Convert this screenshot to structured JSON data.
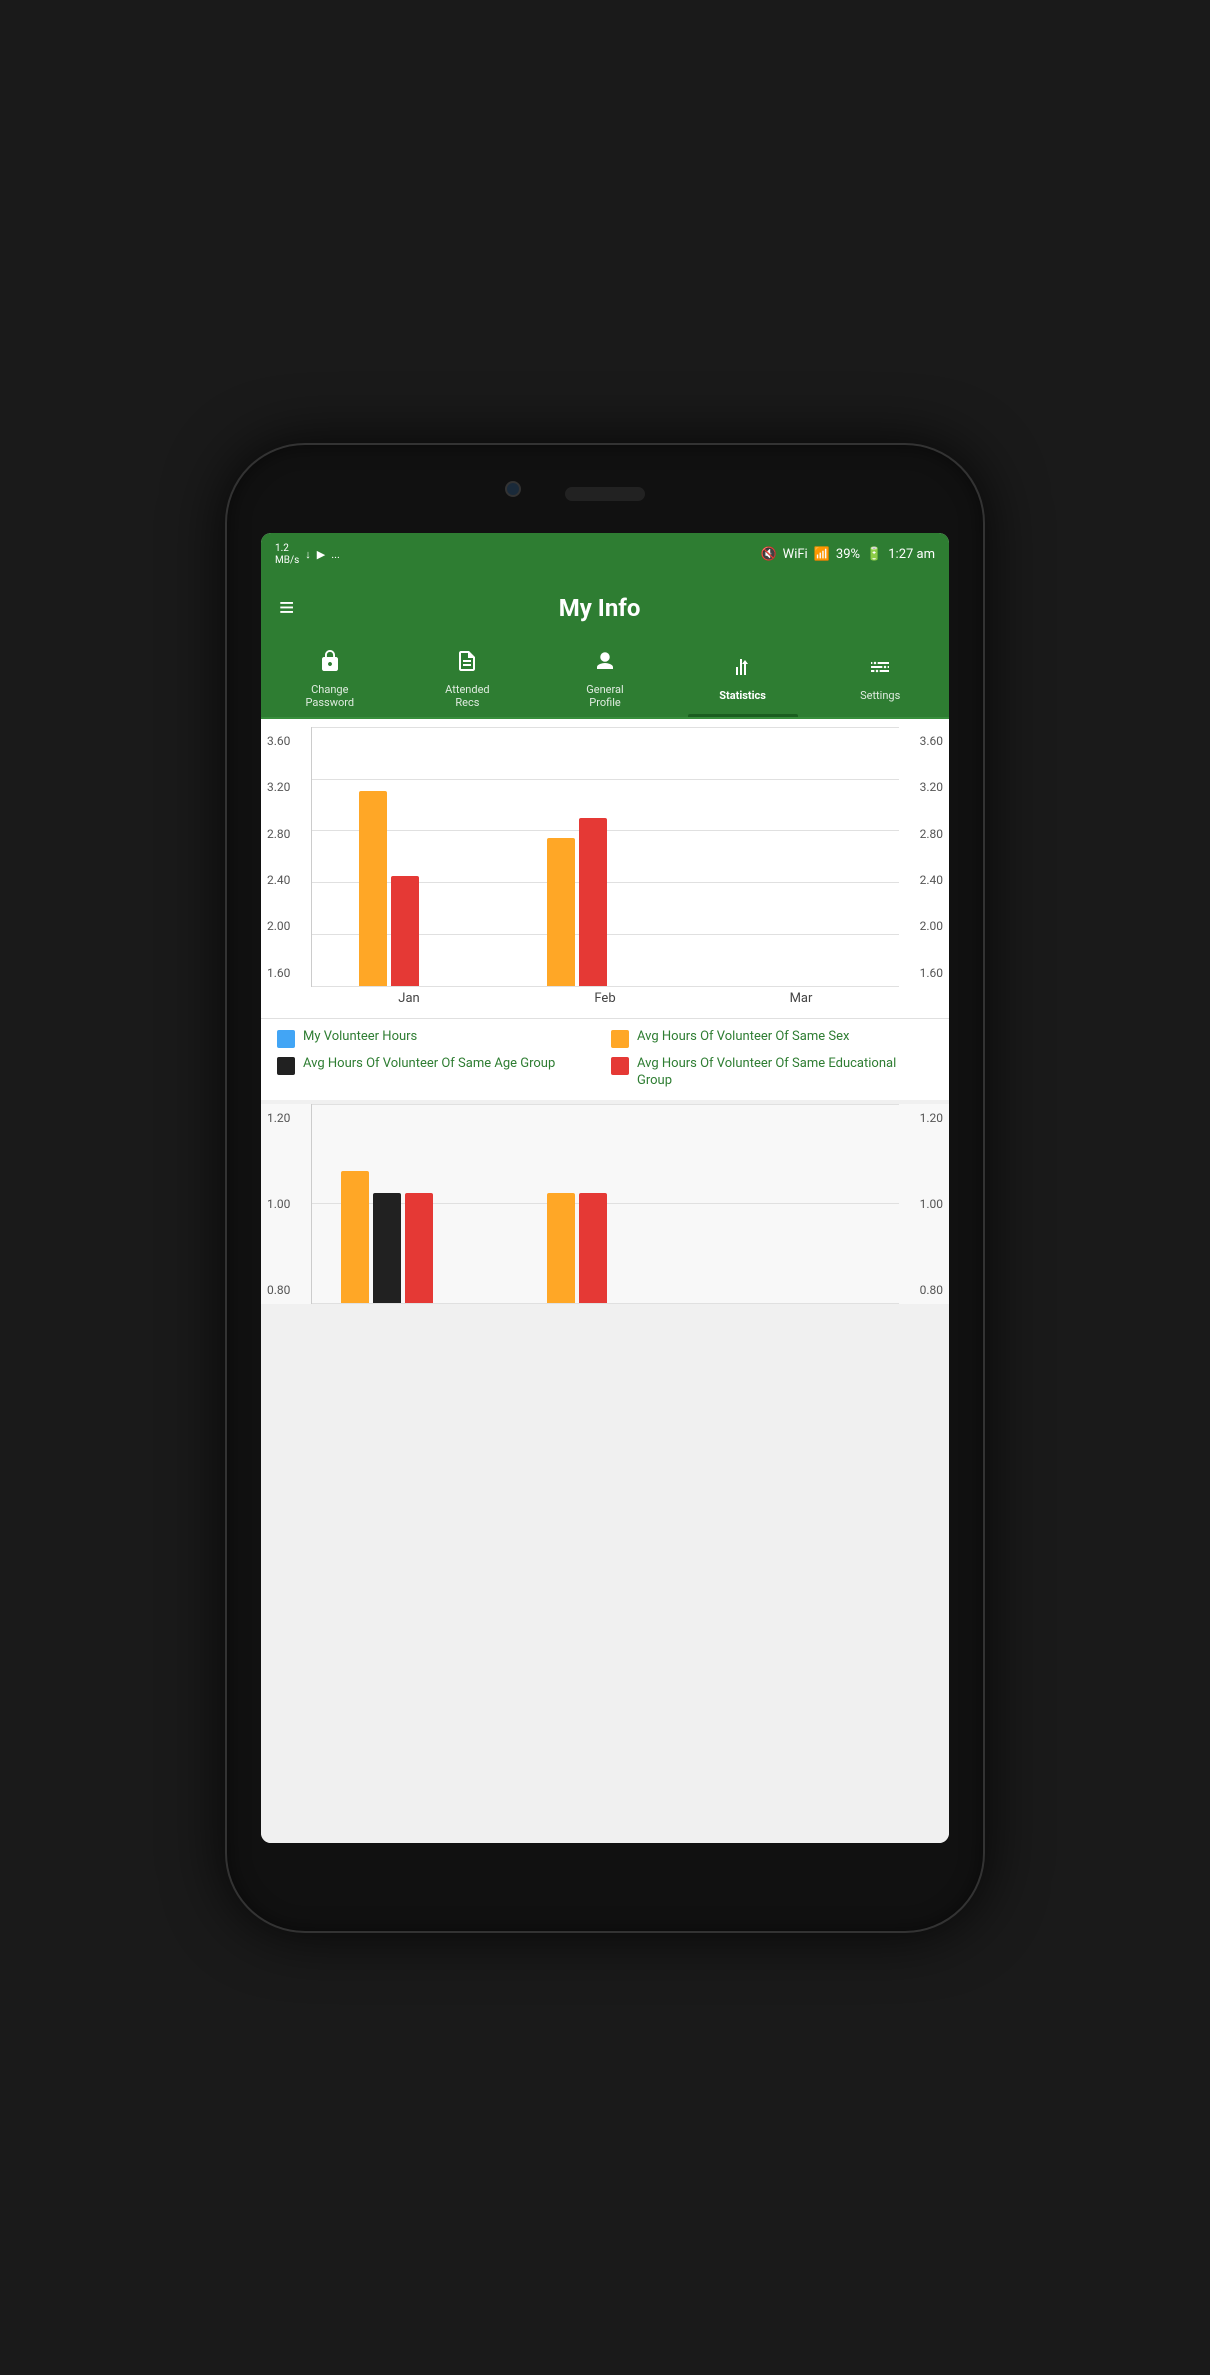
{
  "status_bar": {
    "left": "1.2 MB/s ↓ ▶ ...",
    "right": "🔇 WiFi 📶 39% 🔋 1:27 am"
  },
  "app_bar": {
    "title": "My Info",
    "menu_icon": "≡"
  },
  "tabs": [
    {
      "id": "change-password",
      "label": "Change\nPassword",
      "icon": "🔒",
      "active": false
    },
    {
      "id": "attended-recs",
      "label": "Attended\nRecs",
      "icon": "📋",
      "active": false
    },
    {
      "id": "general-profile",
      "label": "General\nProfile",
      "icon": "👤",
      "active": false
    },
    {
      "id": "statistics",
      "label": "Statistics",
      "icon": "📊",
      "active": true
    },
    {
      "id": "settings",
      "label": "Settings",
      "icon": "⚙",
      "active": false
    }
  ],
  "chart1": {
    "y_labels": [
      "3.60",
      "3.20",
      "2.80",
      "2.40",
      "2.00",
      "1.60"
    ],
    "months": [
      "Jan",
      "Feb",
      "Mar"
    ],
    "bars": {
      "jan": {
        "orange": 85,
        "red": 50
      },
      "feb": {
        "orange": 62,
        "red": 72
      },
      "mar": {
        "orange": 0,
        "red": 0
      }
    }
  },
  "legend": {
    "items": [
      {
        "color": "#42a5f5",
        "text": "My Volunteer Hours"
      },
      {
        "color": "#FFA726",
        "text": "Avg Hours Of Volunteer Of Same Sex"
      },
      {
        "color": "#212121",
        "text": "Avg Hours Of Volunteer Of Same Age Group"
      },
      {
        "color": "#e53935",
        "text": "Avg Hours Of Volunteer Of Same Educational Group"
      }
    ]
  },
  "chart2": {
    "y_labels": [
      "1.20",
      "1.00",
      "0.80"
    ],
    "bars": {
      "jan": {
        "orange": 90,
        "black": 75,
        "red": 75
      },
      "feb": {
        "orange": 75,
        "black": 0,
        "red": 75
      },
      "mar": {
        "orange": 0,
        "black": 0,
        "red": 0
      }
    }
  }
}
